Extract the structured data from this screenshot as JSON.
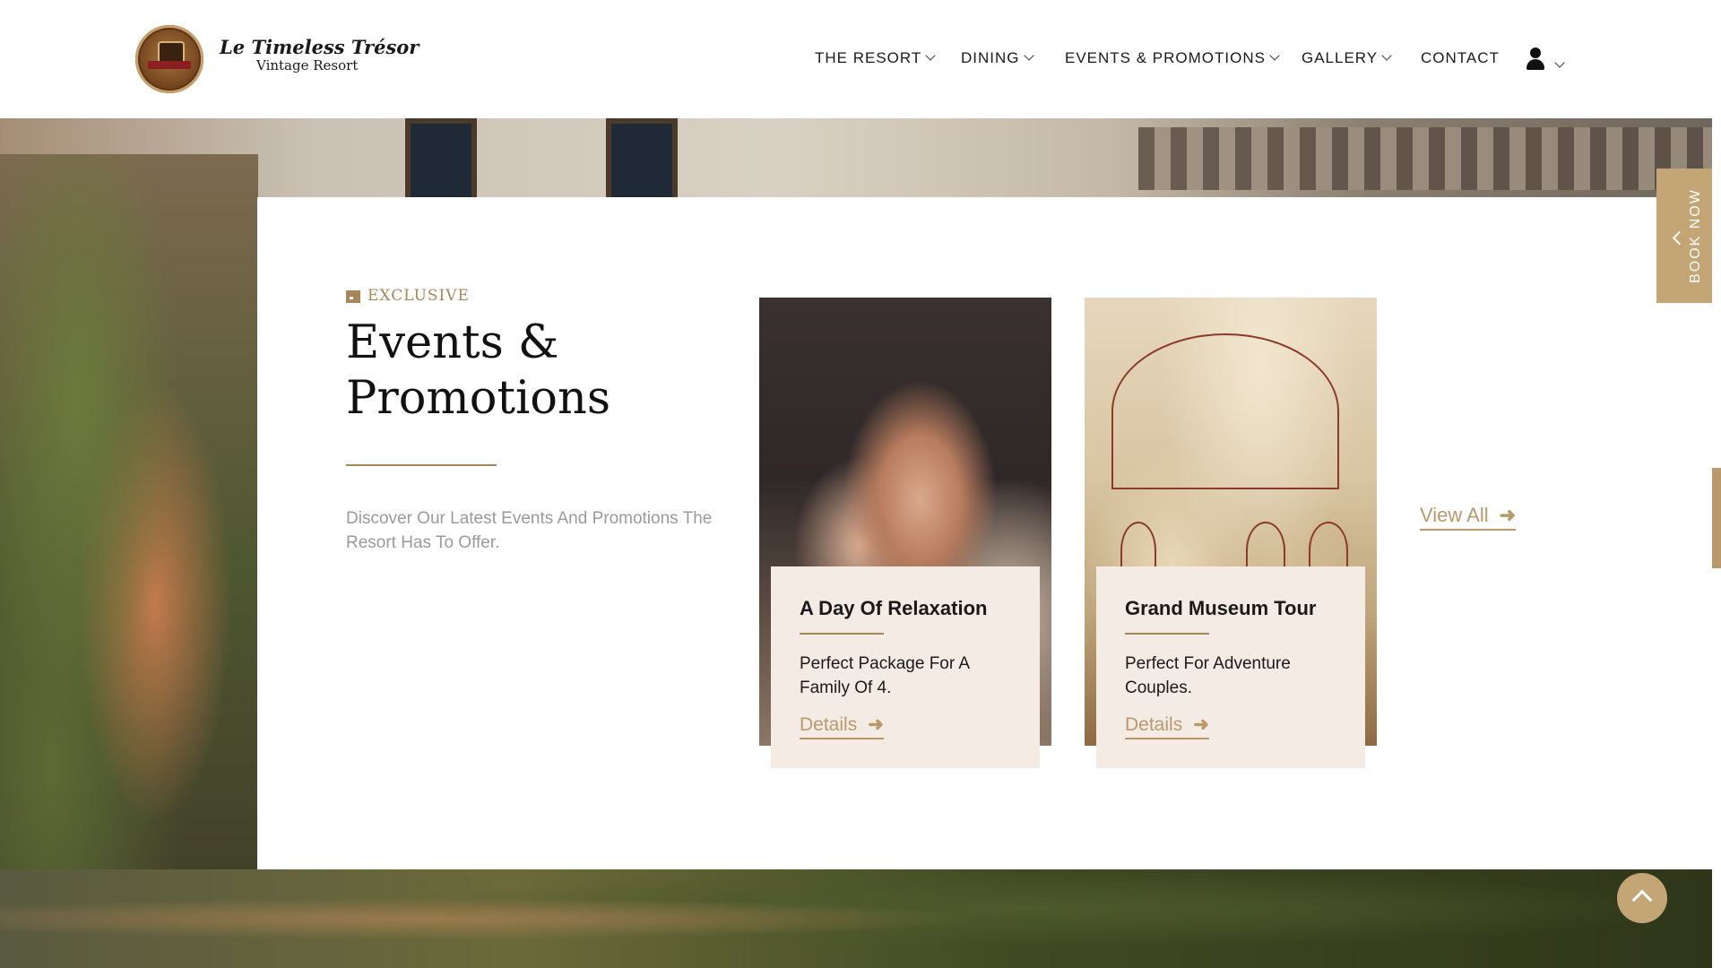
{
  "brand": {
    "name_line1": "Le Timeless Trésor",
    "name_line2": "Vintage Resort"
  },
  "nav": {
    "items": [
      {
        "label": "THE RESORT",
        "has_dropdown": true
      },
      {
        "label": "DINING",
        "has_dropdown": true
      },
      {
        "label": "EVENTS & PROMOTIONS",
        "has_dropdown": true
      },
      {
        "label": "GALLERY",
        "has_dropdown": true
      },
      {
        "label": "CONTACT",
        "has_dropdown": false
      }
    ],
    "user_icon": "user-icon"
  },
  "section": {
    "eyebrow": "EXCLUSIVE",
    "eyebrow_icon": "calendar-icon",
    "title": "Events & Promotions",
    "description": "Discover Our Latest Events And Promotions The Resort Has To Offer.",
    "view_all": "View All"
  },
  "cards": [
    {
      "title": "A Day Of Relaxation",
      "description": "Perfect Package For A Family Of 4.",
      "link": "Details"
    },
    {
      "title": "Grand Museum Tour",
      "description": "Perfect For Adventure Couples.",
      "link": "Details"
    }
  ],
  "side_tab": {
    "label": "BOOK NOW"
  },
  "colors": {
    "accent_gold": "#b7996c",
    "card_bg": "#f4ece4",
    "text_dark": "#1a1a1a",
    "text_muted": "#9a9a9a"
  }
}
